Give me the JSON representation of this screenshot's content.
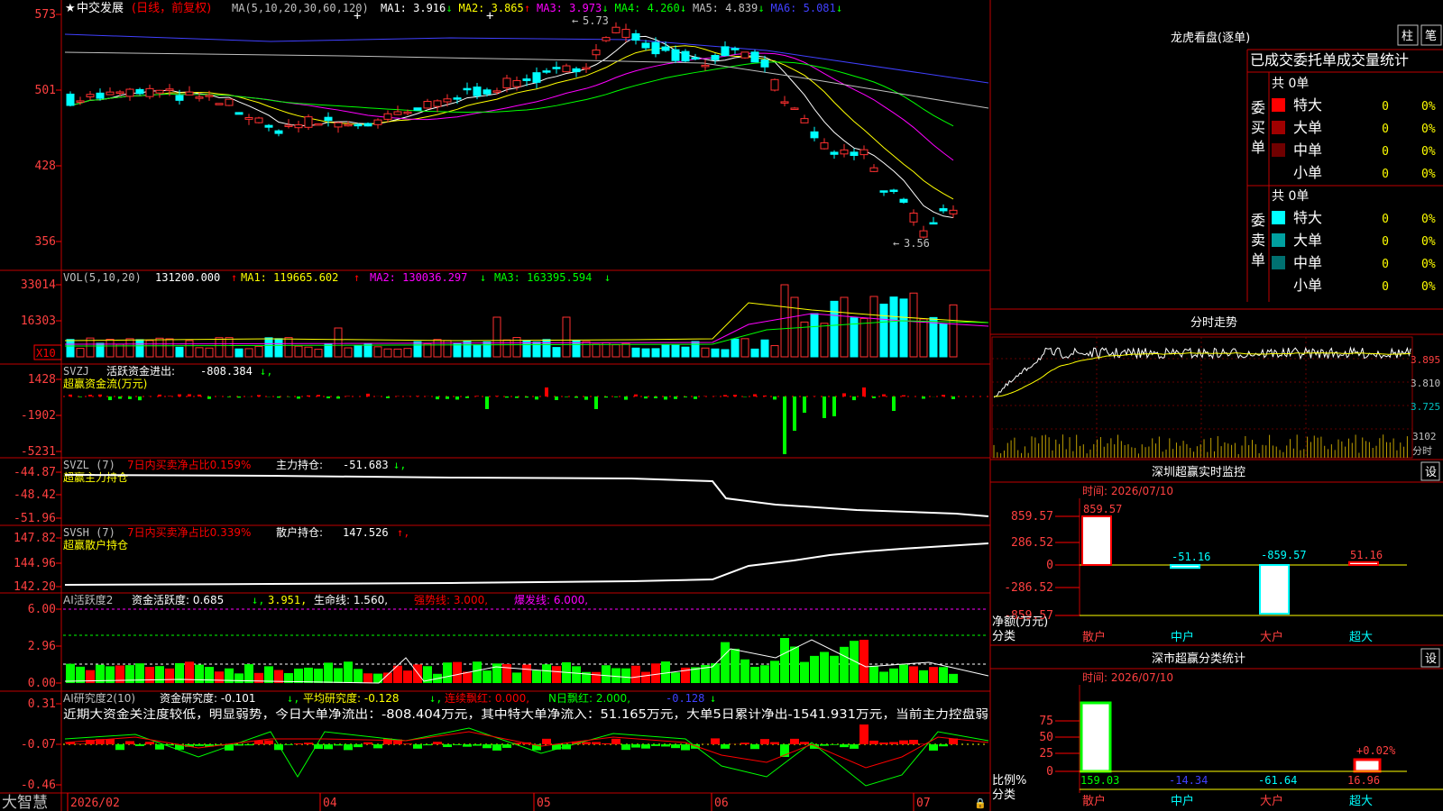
{
  "main": {
    "star": "★",
    "stock_name": "中交发展",
    "period": "(日线，前复权)",
    "ma_params": "MA(5,10,20,30,60,120)",
    "ma_values": [
      {
        "label": "MA1:",
        "value": "3.916",
        "arrow": "↓",
        "color": "#ffffff"
      },
      {
        "label": "MA2:",
        "value": "3.865",
        "arrow": "↑",
        "color": "#ffff00"
      },
      {
        "label": "MA3:",
        "value": "3.973",
        "arrow": "↓",
        "color": "#ff00ff"
      },
      {
        "label": "MA4:",
        "value": "4.260",
        "arrow": "↓",
        "color": "#00ff00"
      },
      {
        "label": "MA5:",
        "value": "4.839",
        "arrow": "↓",
        "color": "#c0c0c0"
      },
      {
        "label": "MA6:",
        "value": "5.081",
        "arrow": "↓",
        "color": "#4040ff"
      }
    ],
    "y_ticks": [
      "573",
      "501",
      "428",
      "356"
    ],
    "high_label": "5.73",
    "low_label": "3.56",
    "high_marker": "←",
    "low_marker": "←"
  },
  "vol": {
    "header": "VOL(5,10,20)",
    "value": "131200.000",
    "ma1": "MA1: 119665.602",
    "ma2": "MA2: 130036.297",
    "ma3": "MA3: 163395.594",
    "y_ticks": [
      "33014",
      "16303"
    ],
    "unit": "X10"
  },
  "svzj": {
    "header": "SVZJ",
    "label": "活跃资金进出:",
    "value": "-808.384",
    "sub": "超赢资金流(万元)",
    "y_ticks": [
      "1428",
      "-1902",
      "-5231"
    ]
  },
  "svzl": {
    "header": "SVZL (7)",
    "ratio": "7日内买卖净占比0.159%",
    "label": "主力持仓:",
    "value": "-51.683",
    "sub": "超赢主力持仓",
    "y_ticks": [
      "-44.87",
      "-48.42",
      "-51.96"
    ]
  },
  "svsh": {
    "header": "SVSH (7)",
    "ratio": "7日内买卖净占比0.339%",
    "label": "散户持仓:",
    "value": "147.526",
    "sub": "超赢散户持仓",
    "y_ticks": [
      "147.82",
      "144.96",
      "142.20"
    ]
  },
  "ai1": {
    "header": "AI活跃度2",
    "a": "资金活跃度: 0.685",
    "b": "3.951,",
    "c": "生命线: 1.560,",
    "d": "强势线: 3.000,",
    "e": "爆发线: 6.000,",
    "y_ticks": [
      "6.00",
      "2.96",
      "0.00"
    ]
  },
  "ai2": {
    "header": "AI研究度2(10)",
    "a": "资金研究度: -0.101",
    "b": "平均研究度: -0.128",
    "c": "连续飘红: 0.000,",
    "d": "N日飘红: 2.000,",
    "e": "-0.128",
    "text": "近期大资金关注度较低，明显弱势，今日大单净流出：-808.404万元，其中特大单净流入：51.165万元，大单5日累计净出-1541.931万元，当前主力控盘弱",
    "y_ticks": [
      "0.31",
      "-0.07",
      "-0.46"
    ]
  },
  "bottom": {
    "brand": "大智慧",
    "dates": [
      "2026/02",
      "04",
      "05",
      "06",
      "07"
    ]
  },
  "right": {
    "lh_title": "龙虎看盘(逐单)",
    "btn_zhu": "柱",
    "btn_bi": "笔",
    "tabs_label": "已成交委托单成交量统计",
    "buy_title": "委买单",
    "sell_title": "委卖单",
    "buy_total": "共 0单",
    "sell_total": "共 0单",
    "buy_rows": [
      {
        "name": "特大",
        "n": "0",
        "p": "0%",
        "color": "#ff0000"
      },
      {
        "name": "大单",
        "n": "0",
        "p": "0%",
        "color": "#a00000"
      },
      {
        "name": "中单",
        "n": "0",
        "p": "0%",
        "color": "#700000"
      },
      {
        "name": "小单",
        "n": "0",
        "p": "0%",
        "color": ""
      }
    ],
    "sell_rows": [
      {
        "name": "特大",
        "n": "0",
        "p": "0%",
        "color": "#00ffff"
      },
      {
        "name": "大单",
        "n": "0",
        "p": "0%",
        "color": "#00a0a0"
      },
      {
        "name": "中单",
        "n": "0",
        "p": "0%",
        "color": "#007070"
      },
      {
        "name": "小单",
        "n": "0",
        "p": "0%",
        "color": ""
      }
    ],
    "fs_title": "分时走势",
    "fs_ticks": [
      "3.895",
      "3.810",
      "3.725"
    ],
    "fs_vol": "3102",
    "fs_unit": "分时",
    "sz_title": "深圳超赢实时监控",
    "sz_btn": "设",
    "sz_time": "时间: 2026/07/10",
    "sz_ticks": [
      "859.57",
      "286.52",
      "0",
      "-286.52",
      "-859.57"
    ],
    "sz_vals": [
      "859.57",
      "-51.16",
      "-859.57",
      "51.16"
    ],
    "sz_ylabel": "净额(万元)",
    "sz_xlabel": "分类",
    "cats": [
      "散户",
      "中户",
      "大户",
      "超大"
    ],
    "fl_title": "深市超赢分类统计",
    "fl_btn": "设",
    "fl_time": "时间: 2026/07/10",
    "fl_ticks": [
      "75",
      "50",
      "25",
      "0"
    ],
    "fl_vals": [
      "159.03",
      "-14.34",
      "-61.64",
      "16.96"
    ],
    "fl_pct": "+0.02%",
    "fl_ylabel": "比例%",
    "fl_xlabel": "分类"
  }
}
